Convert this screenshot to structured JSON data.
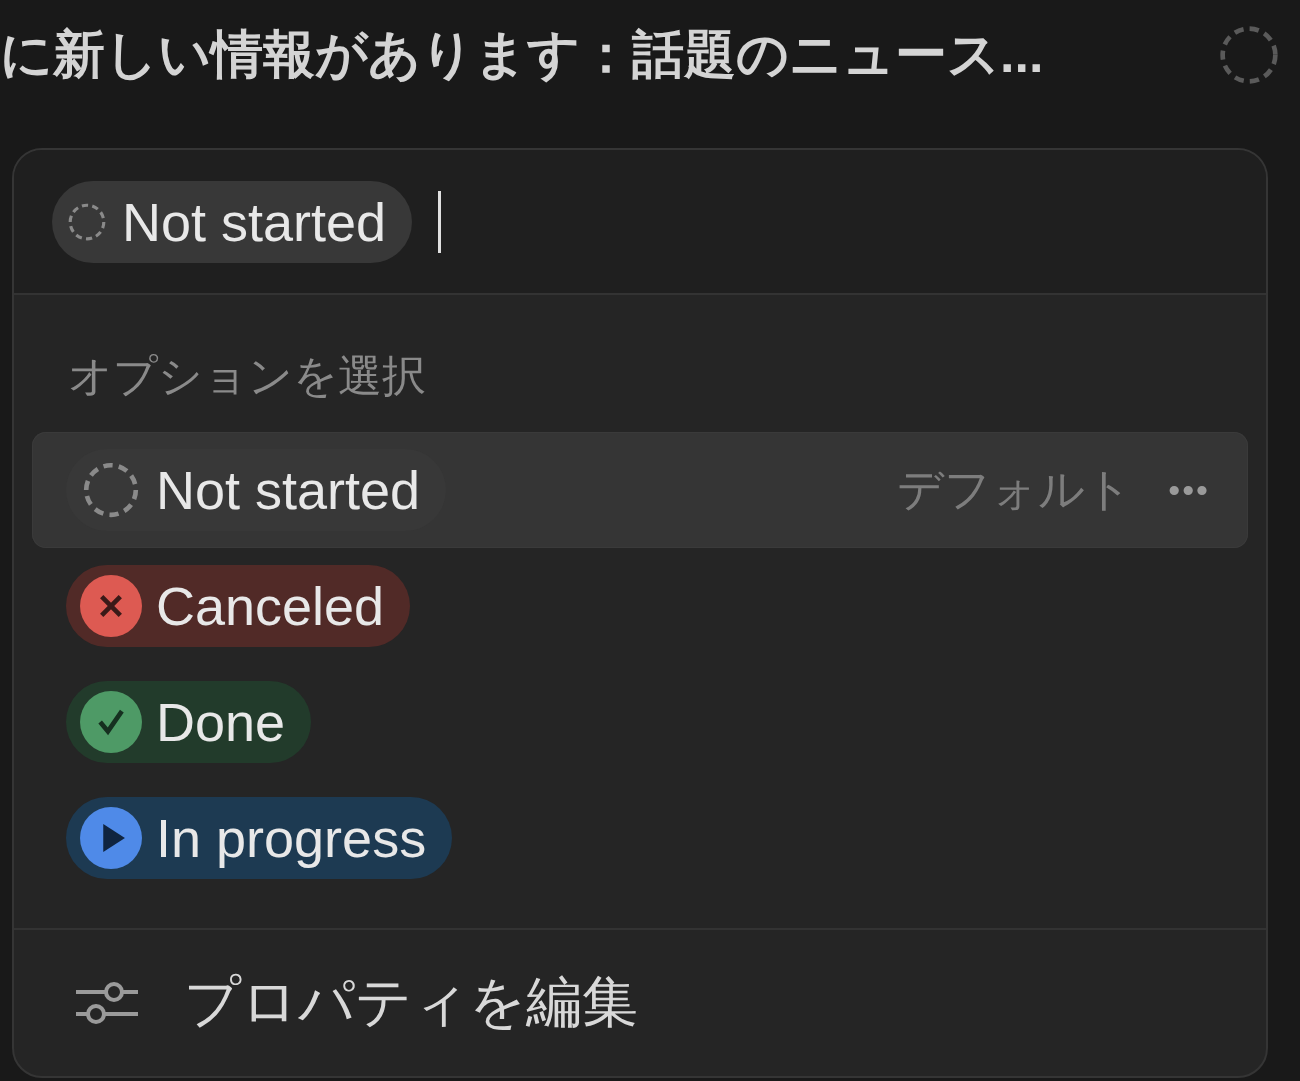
{
  "background_row": {
    "title": "に新しい情報があります：話題のニュース..."
  },
  "popup": {
    "current": {
      "label": "Not started",
      "kind": "not_started"
    },
    "section_label": "オプションを選択",
    "options": [
      {
        "label": "Not started",
        "kind": "not_started",
        "selected": true,
        "note": "デフォルト",
        "more": "•••"
      },
      {
        "label": "Canceled",
        "kind": "canceled",
        "selected": false
      },
      {
        "label": "Done",
        "kind": "done",
        "selected": false
      },
      {
        "label": "In progress",
        "kind": "in_progress",
        "selected": false
      }
    ],
    "footer": {
      "label": "プロパティを編集"
    }
  }
}
